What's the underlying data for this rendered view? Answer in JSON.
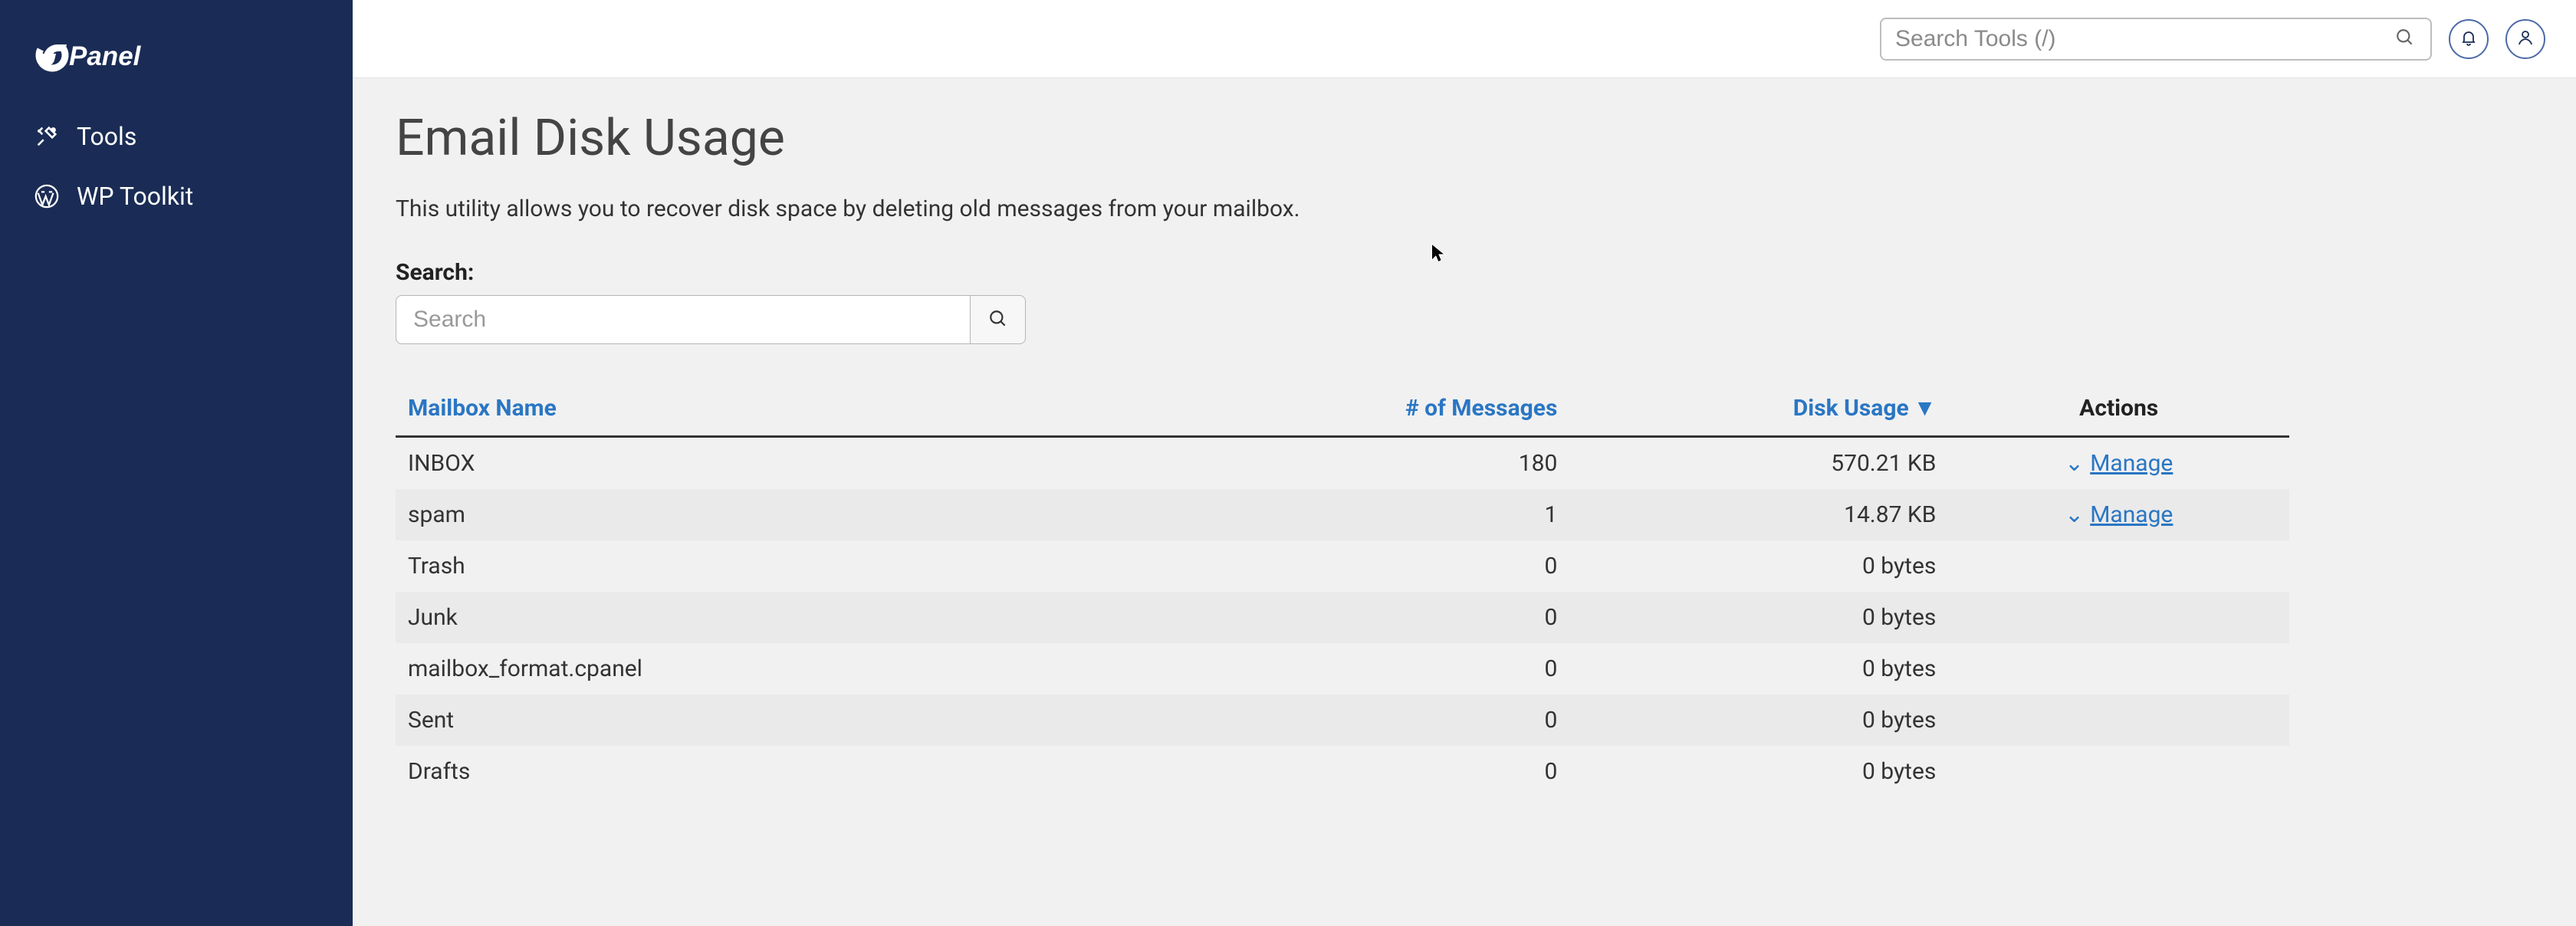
{
  "brand": "cPanel",
  "sidebar": {
    "items": [
      {
        "label": "Tools",
        "icon": "tools-icon"
      },
      {
        "label": "WP Toolkit",
        "icon": "wordpress-icon"
      }
    ]
  },
  "topbar": {
    "search_placeholder": "Search Tools (/)"
  },
  "page": {
    "title": "Email Disk Usage",
    "description": "This utility allows you to recover disk space by deleting old messages from your mailbox.",
    "search_label": "Search:",
    "search_placeholder": "Search"
  },
  "table": {
    "headers": {
      "name": "Mailbox Name",
      "messages": "# of Messages",
      "usage": "Disk Usage",
      "actions": "Actions"
    },
    "sort_indicator": "▼",
    "manage_label": "Manage",
    "rows": [
      {
        "name": "INBOX",
        "messages": "180",
        "usage": "570.21 KB",
        "has_manage": true
      },
      {
        "name": "spam",
        "messages": "1",
        "usage": "14.87 KB",
        "has_manage": true
      },
      {
        "name": "Trash",
        "messages": "0",
        "usage": "0 bytes",
        "has_manage": false
      },
      {
        "name": "Junk",
        "messages": "0",
        "usage": "0 bytes",
        "has_manage": false
      },
      {
        "name": "mailbox_format.cpanel",
        "messages": "0",
        "usage": "0 bytes",
        "has_manage": false
      },
      {
        "name": "Sent",
        "messages": "0",
        "usage": "0 bytes",
        "has_manage": false
      },
      {
        "name": "Drafts",
        "messages": "0",
        "usage": "0 bytes",
        "has_manage": false
      }
    ]
  }
}
